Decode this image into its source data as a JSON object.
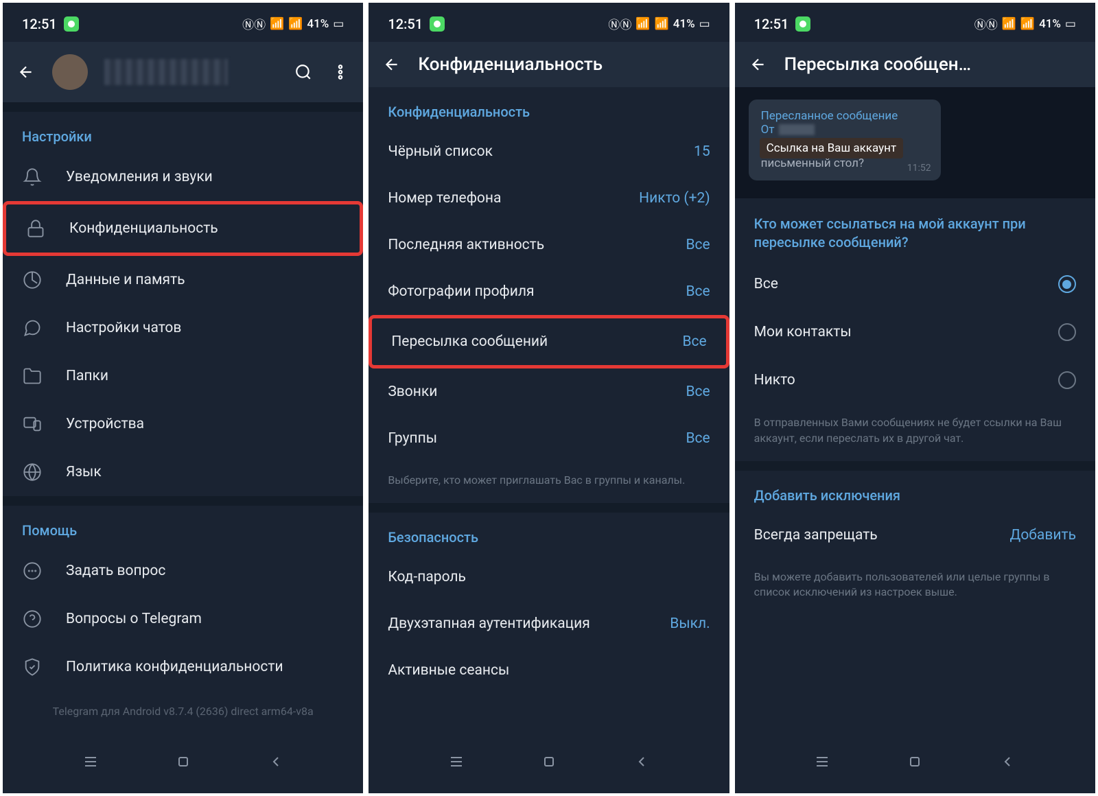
{
  "status": {
    "time": "12:51",
    "indicators": "41%",
    "nfc": "N"
  },
  "phone1": {
    "header": {
      "search": "search",
      "menu": "menu"
    },
    "sections": {
      "settings_header": "Настройки",
      "help_header": "Помощь"
    },
    "items": {
      "notifications": "Уведомления и звуки",
      "privacy": "Конфиденциальность",
      "data": "Данные и память",
      "chat": "Настройки чатов",
      "folders": "Папки",
      "devices": "Устройства",
      "language": "Язык",
      "ask": "Задать вопрос",
      "faq": "Вопросы о Telegram",
      "policy": "Политика конфиденциальности"
    },
    "version": "Telegram для Android v8.7.4 (2636) direct arm64-v8a"
  },
  "phone2": {
    "title": "Конфиденциальность",
    "section_privacy": "Конфиденциальность",
    "section_security": "Безопасность",
    "items": {
      "blacklist": {
        "label": "Чёрный список",
        "value": "15"
      },
      "phone": {
        "label": "Номер телефона",
        "value": "Никто (+2)"
      },
      "lastseen": {
        "label": "Последняя активность",
        "value": "Все"
      },
      "photos": {
        "label": "Фотографии профиля",
        "value": "Все"
      },
      "forward": {
        "label": "Пересылка сообщений",
        "value": "Все"
      },
      "calls": {
        "label": "Звонки",
        "value": "Все"
      },
      "groups": {
        "label": "Группы",
        "value": "Все"
      },
      "passcode": {
        "label": "Код-пароль",
        "value": ""
      },
      "twostep": {
        "label": "Двухэтапная аутентификация",
        "value": "Выкл."
      },
      "sessions": {
        "label": "Активные сеансы",
        "value": ""
      }
    },
    "footer_groups": "Выберите, кто может приглашать Вас в группы и каналы."
  },
  "phone3": {
    "title": "Пересылка сообщен…",
    "preview": {
      "forwarded": "Пересланное сообщение",
      "from_prefix": "От",
      "text": "Чем ворон похож на письменный стол?",
      "overlay": "Ссылка на Ваш аккаунт",
      "time": "11:52"
    },
    "question": "Кто может ссылаться на мой аккаунт при пересылке сообщений?",
    "options": {
      "everybody": "Все",
      "contacts": "Мои контакты",
      "nobody": "Никто"
    },
    "footer_link": "В отправленных Вами сообщениях не будет ссылки на Ваш аккаунт, если переслать их в другой чат.",
    "exceptions_header": "Добавить исключения",
    "exception": {
      "label": "Всегда запрещать",
      "action": "Добавить"
    },
    "footer_exceptions": "Вы можете добавить пользователей или целые группы в список исключений из настроек выше."
  }
}
